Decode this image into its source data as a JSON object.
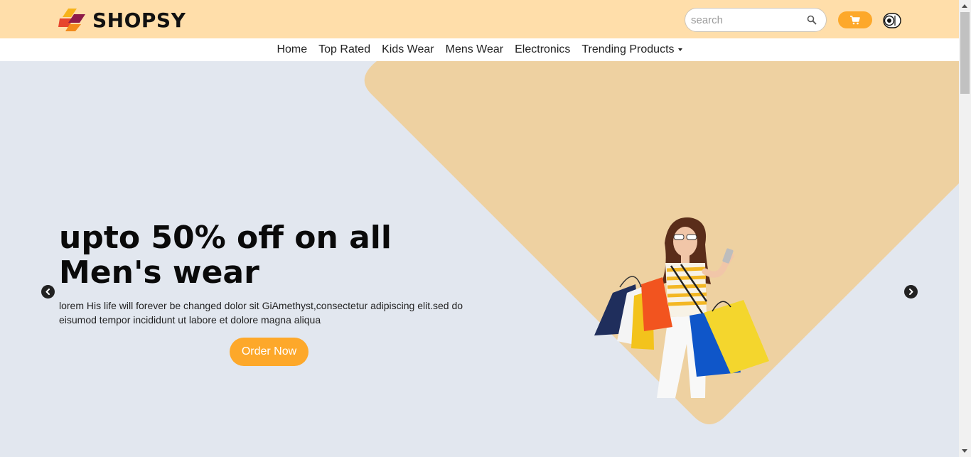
{
  "brand": {
    "name": "SHOPSY"
  },
  "search": {
    "placeholder": "search"
  },
  "nav": {
    "items": [
      {
        "label": "Home"
      },
      {
        "label": "Top Rated"
      },
      {
        "label": "Kids Wear"
      },
      {
        "label": "Mens Wear"
      },
      {
        "label": "Electronics"
      },
      {
        "label": "Trending Products"
      }
    ]
  },
  "hero": {
    "title": "upto 50% off on all Men's wear",
    "description": "lorem His life will forever be changed dolor sit GiAmethyst,consectetur adipiscing elit.sed do eisumod tempor incididunt ut labore et dolore magna aliqua",
    "cta_label": "Order Now"
  },
  "icons": {
    "search": "search-icon",
    "cart": "cart-icon",
    "theme": "theme-toggle-icon",
    "prev": "chevron-left-icon",
    "next": "chevron-right-icon"
  },
  "colors": {
    "topbar": "#ffdeaa",
    "accent": "#fda82a",
    "hero_bg": "#e2e7ef",
    "hero_shape": "#eed1a1"
  }
}
